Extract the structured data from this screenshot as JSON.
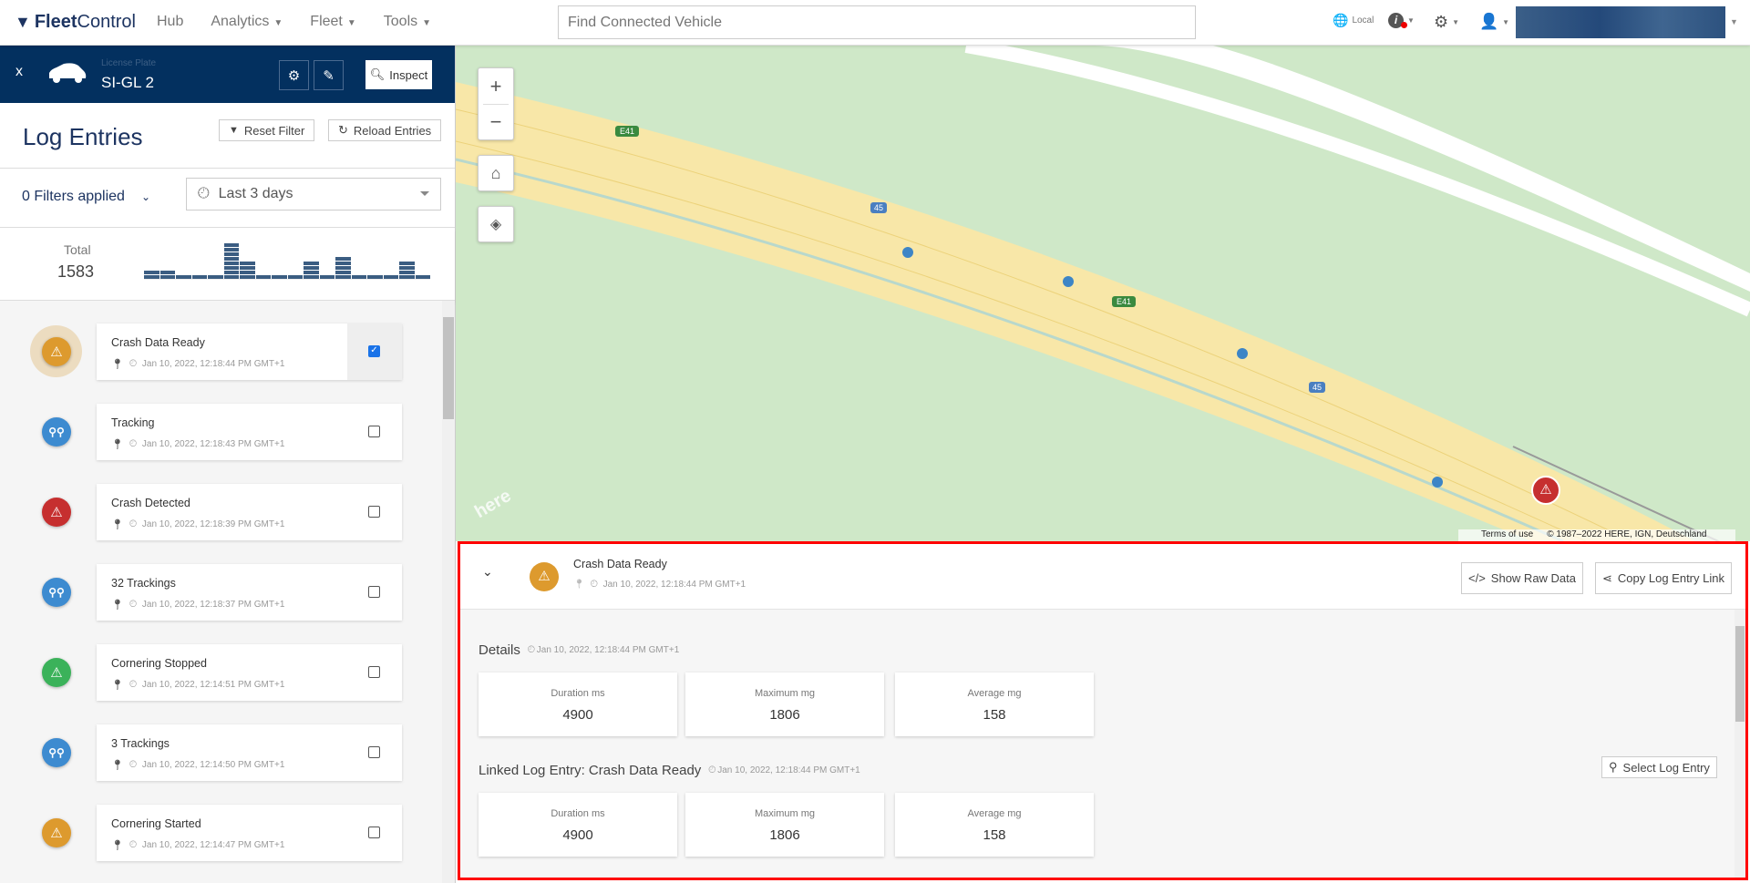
{
  "header": {
    "brand_bold": "Fleet",
    "brand_rest": "Control",
    "nav": [
      {
        "label": "Hub",
        "caret": false
      },
      {
        "label": "Analytics",
        "caret": true
      },
      {
        "label": "Fleet",
        "caret": true
      },
      {
        "label": "Tools",
        "caret": true
      }
    ],
    "search_placeholder": "Find Connected Vehicle",
    "locale_label": "Local",
    "icons": [
      "globe-icon",
      "info-icon",
      "gear-icon",
      "user-icon"
    ]
  },
  "vehicle": {
    "license_label": "License Plate",
    "license_plate": "SI-GL 2",
    "inspect_label": "Inspect",
    "close_label": "x"
  },
  "log": {
    "title": "Log Entries",
    "reset_filter": "Reset Filter",
    "reload_entries": "Reload Entries",
    "filters_applied": "0 Filters applied",
    "time_range": "Last 3 days",
    "total_label": "Total",
    "total_value": "1583",
    "histogram": [
      2,
      2,
      1,
      1,
      1,
      8,
      4,
      1,
      1,
      1,
      4,
      1,
      5,
      1,
      1,
      1,
      4,
      1
    ],
    "entries": [
      {
        "title": "Crash Data Ready",
        "time": "Jan 10, 2022, 12:18:44 PM GMT+1",
        "type": "warning",
        "color": "#dd9a2e",
        "checked": true
      },
      {
        "title": "Tracking",
        "time": "Jan 10, 2022, 12:18:43 PM GMT+1",
        "type": "tracking",
        "color": "#3d8bd0",
        "checked": false
      },
      {
        "title": "Crash Detected",
        "time": "Jan 10, 2022, 12:18:39 PM GMT+1",
        "type": "warning",
        "color": "#c62f2f",
        "checked": false
      },
      {
        "title": "32 Trackings",
        "time": "Jan 10, 2022, 12:18:37 PM GMT+1",
        "type": "tracking",
        "color": "#3d8bd0",
        "checked": false
      },
      {
        "title": "Cornering Stopped",
        "time": "Jan 10, 2022, 12:14:51 PM GMT+1",
        "type": "warning",
        "color": "#3bb25a",
        "checked": false
      },
      {
        "title": "3 Trackings",
        "time": "Jan 10, 2022, 12:14:50 PM GMT+1",
        "type": "tracking",
        "color": "#3d8bd0",
        "checked": false
      },
      {
        "title": "Cornering Started",
        "time": "Jan 10, 2022, 12:14:47 PM GMT+1",
        "type": "warning",
        "color": "#dd9a2e",
        "checked": false
      }
    ]
  },
  "map": {
    "road_labels": [
      "E41",
      "45",
      "E41",
      "45"
    ],
    "terms": "Terms of use",
    "copyright": "© 1987–2022 HERE, IGN, Deutschland",
    "watermark": "here"
  },
  "detail": {
    "title": "Crash Data Ready",
    "time": "Jan 10, 2022, 12:18:44 PM GMT+1",
    "show_raw": "Show Raw Data",
    "copy_link": "Copy Log Entry Link",
    "details_label": "Details",
    "details_time": "Jan 10, 2022, 12:18:44 PM GMT+1",
    "stats": [
      {
        "label": "Duration ms",
        "value": "4900"
      },
      {
        "label": "Maximum mg",
        "value": "1806"
      },
      {
        "label": "Average mg",
        "value": "158"
      }
    ],
    "linked_label": "Linked Log Entry: Crash Data Ready",
    "linked_time": "Jan 10, 2022, 12:18:44 PM GMT+1",
    "select_entry": "Select Log Entry",
    "linked_stats": [
      {
        "label": "Duration ms",
        "value": "4900"
      },
      {
        "label": "Maximum mg",
        "value": "1806"
      },
      {
        "label": "Average mg",
        "value": "158"
      }
    ]
  }
}
